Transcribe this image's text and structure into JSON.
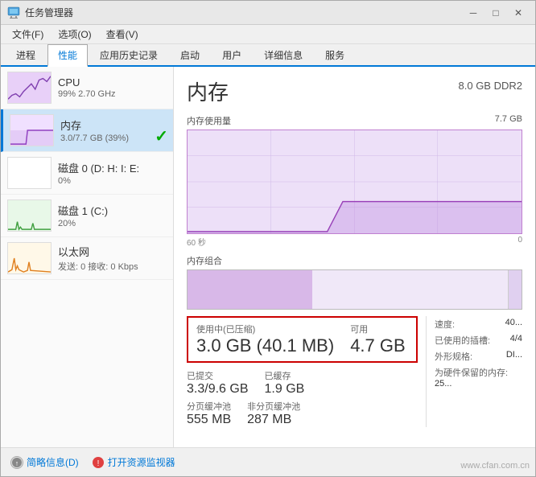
{
  "window": {
    "title": "任务管理器",
    "controls": {
      "min": "─",
      "max": "□",
      "close": "✕"
    }
  },
  "menu": {
    "items": [
      "文件(F)",
      "选项(O)",
      "查看(V)"
    ]
  },
  "tabs": {
    "items": [
      "进程",
      "性能",
      "应用历史记录",
      "启动",
      "用户",
      "详细信息",
      "服务"
    ],
    "active": 1
  },
  "sidebar": {
    "items": [
      {
        "id": "cpu",
        "name": "CPU",
        "stat": "99% 2.70 GHz",
        "active": false
      },
      {
        "id": "memory",
        "name": "内存",
        "stat": "3.0/7.7 GB (39%)",
        "active": true
      },
      {
        "id": "disk0",
        "name": "磁盘 0 (D: H: I: E:",
        "stat": "0%",
        "active": false
      },
      {
        "id": "disk1",
        "name": "磁盘 1 (C:)",
        "stat": "20%",
        "active": false
      },
      {
        "id": "ethernet",
        "name": "以太网",
        "stat": "发送: 0 接收: 0 Kbps",
        "active": false
      }
    ]
  },
  "content": {
    "title": "内存",
    "subtitle": "8.0 GB DDR2",
    "chart": {
      "usage_label": "内存使用量",
      "usage_value": "7.7 GB",
      "time_start": "60 秒",
      "time_end": "0",
      "composition_label": "内存组合"
    },
    "stats": {
      "in_use_label": "使用中(已压缩)",
      "in_use_value": "3.0 GB (40.1 MB)",
      "available_label": "可用",
      "available_value": "4.7 GB",
      "committed_label": "已提交",
      "committed_value": "3.3/9.6 GB",
      "cached_label": "已缓存",
      "cached_value": "1.9 GB",
      "paged_label": "分页缓冲池",
      "paged_value": "555 MB",
      "nonpaged_label": "非分页缓冲池",
      "nonpaged_value": "287 MB"
    },
    "right_stats": {
      "speed_label": "速度:",
      "speed_value": "40...",
      "slots_label": "已使用的插槽:",
      "slots_value": "4/4",
      "form_label": "外形规格:",
      "form_value": "DI...",
      "reserved_label": "为硬件保留的内存:",
      "reserved_value": "25..."
    }
  },
  "bottom": {
    "summary_label": "简略信息(D)",
    "monitor_label": "打开资源监视器"
  },
  "watermark": "www.cfan.com.cn"
}
